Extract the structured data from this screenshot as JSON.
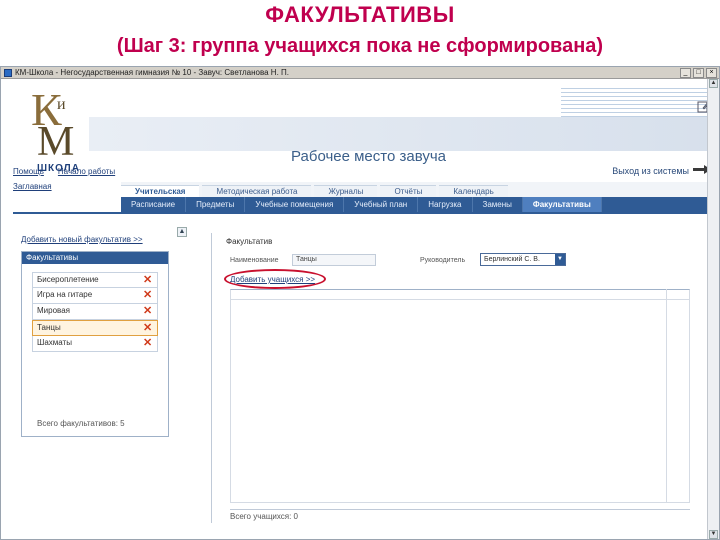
{
  "slide": {
    "title": "ФАКУЛЬТАТИВЫ",
    "subtitle": "(Шаг 3: группа учащихся пока не сформирована)"
  },
  "window": {
    "title": "КМ-Школа - Негосударственная гимназия № 10 - Завуч: Светланова Н. П."
  },
  "header": {
    "logo_letters": {
      "k": "К",
      "i": "и",
      "m": "М"
    },
    "logo_school": "ШКОЛА",
    "app_title": "Рабочее место завуча",
    "exit": "Выход из системы"
  },
  "topnav": [
    "Помощь",
    "Начало работы"
  ],
  "subnav_left": "Заглавная",
  "tabs": [
    {
      "label": "Учительская",
      "active": true
    },
    {
      "label": "Методическая работа",
      "active": false
    },
    {
      "label": "Журналы",
      "active": false
    },
    {
      "label": "Отчёты",
      "active": false
    },
    {
      "label": "Календарь",
      "active": false
    }
  ],
  "subtabs": [
    {
      "label": "Расписание",
      "active": false
    },
    {
      "label": "Предметы",
      "active": false
    },
    {
      "label": "Учебные помещения",
      "active": false
    },
    {
      "label": "Учебный план",
      "active": false
    },
    {
      "label": "Нагрузка",
      "active": false
    },
    {
      "label": "Замены",
      "active": false
    },
    {
      "label": "Факультативы",
      "active": true
    }
  ],
  "left_panel": {
    "add_link": "Добавить новый факультатив >>",
    "list_header": "Факультативы",
    "items": [
      {
        "label": "Бисероплетение",
        "selected": false
      },
      {
        "label": "Игра на гитаре",
        "selected": false
      },
      {
        "label": "Мировая",
        "selected": false
      },
      {
        "label": "Танцы",
        "selected": true
      },
      {
        "label": "Шахматы",
        "selected": false
      }
    ],
    "total": "Всего факультативов: 5"
  },
  "right_panel": {
    "title": "Факультатив",
    "name_label": "Наименование",
    "name_value": "Танцы",
    "leader_label": "Руководитель",
    "leader_value": "Берлинский С. В.",
    "add_student": "Добавить учащихся >>",
    "total": "Всего учащихся: 0"
  },
  "colors": {
    "title": "#c0004e",
    "nav_dark": "#2f5b95",
    "highlight_ring": "#c8102e",
    "delete": "#d03a1a"
  }
}
